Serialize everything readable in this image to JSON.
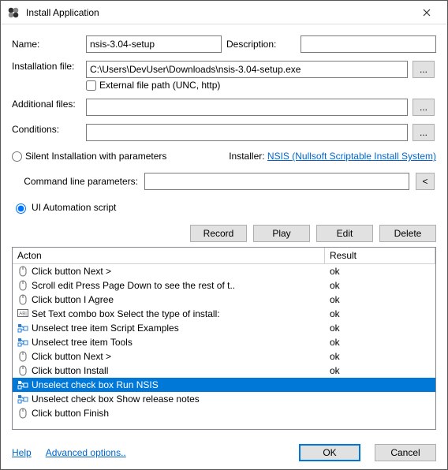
{
  "window": {
    "title": "Install Application"
  },
  "labels": {
    "name": "Name:",
    "description": "Description:",
    "install_file": "Installation file:",
    "ext_path": "External file path (UNC, http)",
    "additional_files": "Additional files:",
    "conditions": "Conditions:",
    "silent": "Silent Installation with parameters",
    "installer": "Installer:",
    "installer_link": "NSIS (Nullsoft Scriptable Install System)",
    "cmd_params": "Command line parameters:",
    "ui_script": "UI Automation script",
    "record": "Record",
    "play": "Play",
    "edit": "Edit",
    "delete": "Delete",
    "col_action": "Acton",
    "col_result": "Result",
    "help": "Help",
    "advanced": "Advanced options..",
    "ok": "OK",
    "cancel": "Cancel",
    "browse": "...",
    "caret": "<"
  },
  "values": {
    "name": "nsis-3.04-setup",
    "description": "",
    "install_file": "C:\\Users\\DevUser\\Downloads\\nsis-3.04-setup.exe",
    "additional_files": "",
    "conditions": "",
    "cmd_params": ""
  },
  "script_rows": [
    {
      "icon": "mouse",
      "action": "Click button Next >",
      "result": "ok",
      "selected": false
    },
    {
      "icon": "mouse",
      "action": "Scroll edit Press Page Down to see the rest of t..",
      "result": "ok",
      "selected": false
    },
    {
      "icon": "mouse",
      "action": "Click button I Agree",
      "result": "ok",
      "selected": false
    },
    {
      "icon": "abi",
      "action": "Set Text combo box Select the type of install:",
      "result": "ok",
      "selected": false
    },
    {
      "icon": "tree",
      "action": "Unselect tree item Script Examples",
      "result": "ok",
      "selected": false
    },
    {
      "icon": "tree",
      "action": "Unselect tree item Tools",
      "result": "ok",
      "selected": false
    },
    {
      "icon": "mouse",
      "action": "Click button Next >",
      "result": "ok",
      "selected": false
    },
    {
      "icon": "mouse",
      "action": "Click button Install",
      "result": "ok",
      "selected": false
    },
    {
      "icon": "tree",
      "action": "Unselect check box Run NSIS",
      "result": "",
      "selected": true
    },
    {
      "icon": "tree",
      "action": "Unselect check box Show release notes",
      "result": "",
      "selected": false
    },
    {
      "icon": "mouse",
      "action": "Click button Finish",
      "result": "",
      "selected": false
    }
  ]
}
